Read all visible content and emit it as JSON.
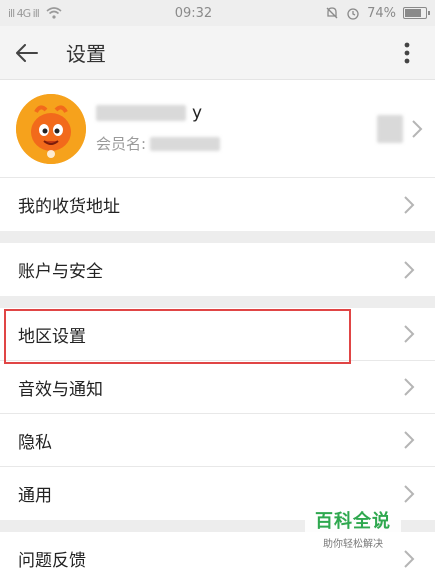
{
  "status_bar": {
    "signal_text": "ill 4G ill",
    "time": "09:32",
    "battery": "74%"
  },
  "app_bar": {
    "title": "设置",
    "back_icon": "arrow-left-icon",
    "more_icon": "more-vertical-icon"
  },
  "profile": {
    "nickname_suffix": "y",
    "member_label": "会员名:",
    "avatar_icon": "mascot-avatar"
  },
  "settings": {
    "address": "我的收货地址",
    "account_security": "账户与安全",
    "region": "地区设置",
    "sound_notify": "音效与通知",
    "privacy": "隐私",
    "general": "通用",
    "feedback": "问题反馈"
  },
  "watermark": {
    "title": "百科全说",
    "subtitle": "助你轻松解决"
  },
  "colors": {
    "highlight": "#e04545",
    "watermark_green": "#2fa84f",
    "avatar_orange": "#f6a21c"
  }
}
